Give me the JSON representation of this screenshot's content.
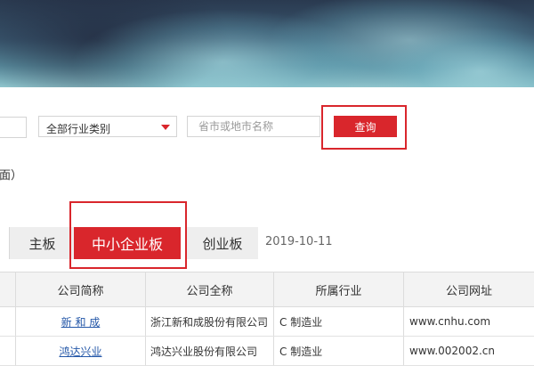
{
  "search": {
    "industry_selected": "全部行业类别",
    "region_placeholder": "省市或地市名称",
    "query_label": "查询"
  },
  "note": "面）",
  "boards": {
    "tabs": [
      "主板",
      "中小企业板",
      "创业板"
    ],
    "active": "中小企业板",
    "date": "2019-10-11"
  },
  "table": {
    "columns": [
      "公司简称",
      "公司全称",
      "所属行业",
      "公司网址"
    ],
    "rows": [
      {
        "short_name": "新 和 成",
        "full_name": "浙江新和成股份有限公司",
        "industry": "C 制造业",
        "website": "www.cnhu.com"
      },
      {
        "short_name": "鸿达兴业",
        "full_name": "鸿达兴业股份有限公司",
        "industry": "C 制造业",
        "website": "www.002002.cn"
      }
    ]
  },
  "colors": {
    "accent": "#d9262c",
    "link": "#2457a8",
    "header_bg": "#f3f3f3"
  }
}
